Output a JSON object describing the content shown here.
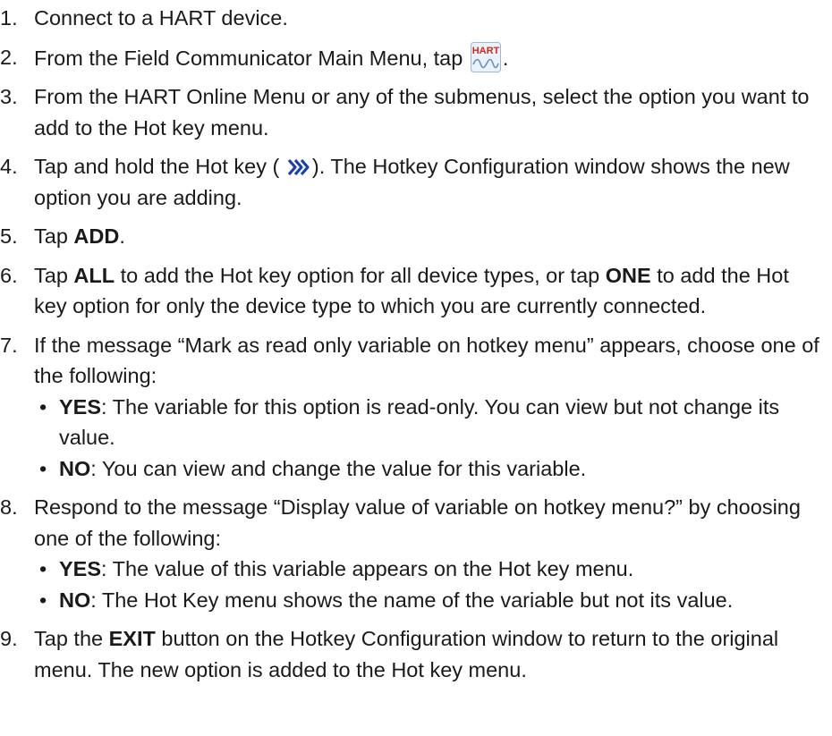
{
  "steps": [
    {
      "num": "1.",
      "text": "Connect to a HART device."
    },
    {
      "num": "2.",
      "pre": "From the Field Communicator Main Menu, tap ",
      "post": ".",
      "icon": "hart-app-icon",
      "icon_text": "HART"
    },
    {
      "num": "3.",
      "text": "From the HART Online Menu or any of the submenus, select the option you want to add to the Hot key menu."
    },
    {
      "num": "4.",
      "pre": "Tap and hold the Hot key ( ",
      "post": "). The Hotkey Configuration window shows the new option you are adding.",
      "icon": "hotkey-chevrons-icon"
    },
    {
      "num": "5.",
      "pre": "Tap ",
      "bold": "ADD",
      "post": "."
    },
    {
      "num": "6.",
      "pre": "Tap ",
      "bold1": "ALL",
      "mid": " to add the Hot key option for all device types, or tap ",
      "bold2": "ONE",
      "post": " to add the Hot key option for only the device type to which you are currently connected."
    },
    {
      "num": "7.",
      "text": "If the message “Mark as read only variable on hotkey menu” appears, choose one of the following:",
      "bullets": [
        {
          "dot": "•",
          "bold": "YES",
          "text": ": The variable for this option is read-only. You can view but not change its value."
        },
        {
          "dot": "•",
          "bold": "NO",
          "text": ": You can view and change the value for this variable."
        }
      ]
    },
    {
      "num": "8.",
      "text": "Respond to the message “Display value of variable on hotkey menu?” by choosing one of the following:",
      "bullets": [
        {
          "dot": "•",
          "bold": "YES",
          "text": ": The value of this variable appears on the Hot key menu."
        },
        {
          "dot": "•",
          "bold": "NO",
          "text": ": The Hot Key menu shows the name of the variable but not its value."
        }
      ]
    },
    {
      "num": "9.",
      "pre": "Tap the ",
      "bold": "EXIT",
      "post": " button on the Hotkey Configuration window to return to the original menu. The new option is added to the Hot key menu."
    }
  ],
  "colors": {
    "text": "#1a1a1a",
    "hart_red": "#d42a1e",
    "hart_bg": "#eaf2fb",
    "hotkey_blue": "#1a3fb0"
  }
}
